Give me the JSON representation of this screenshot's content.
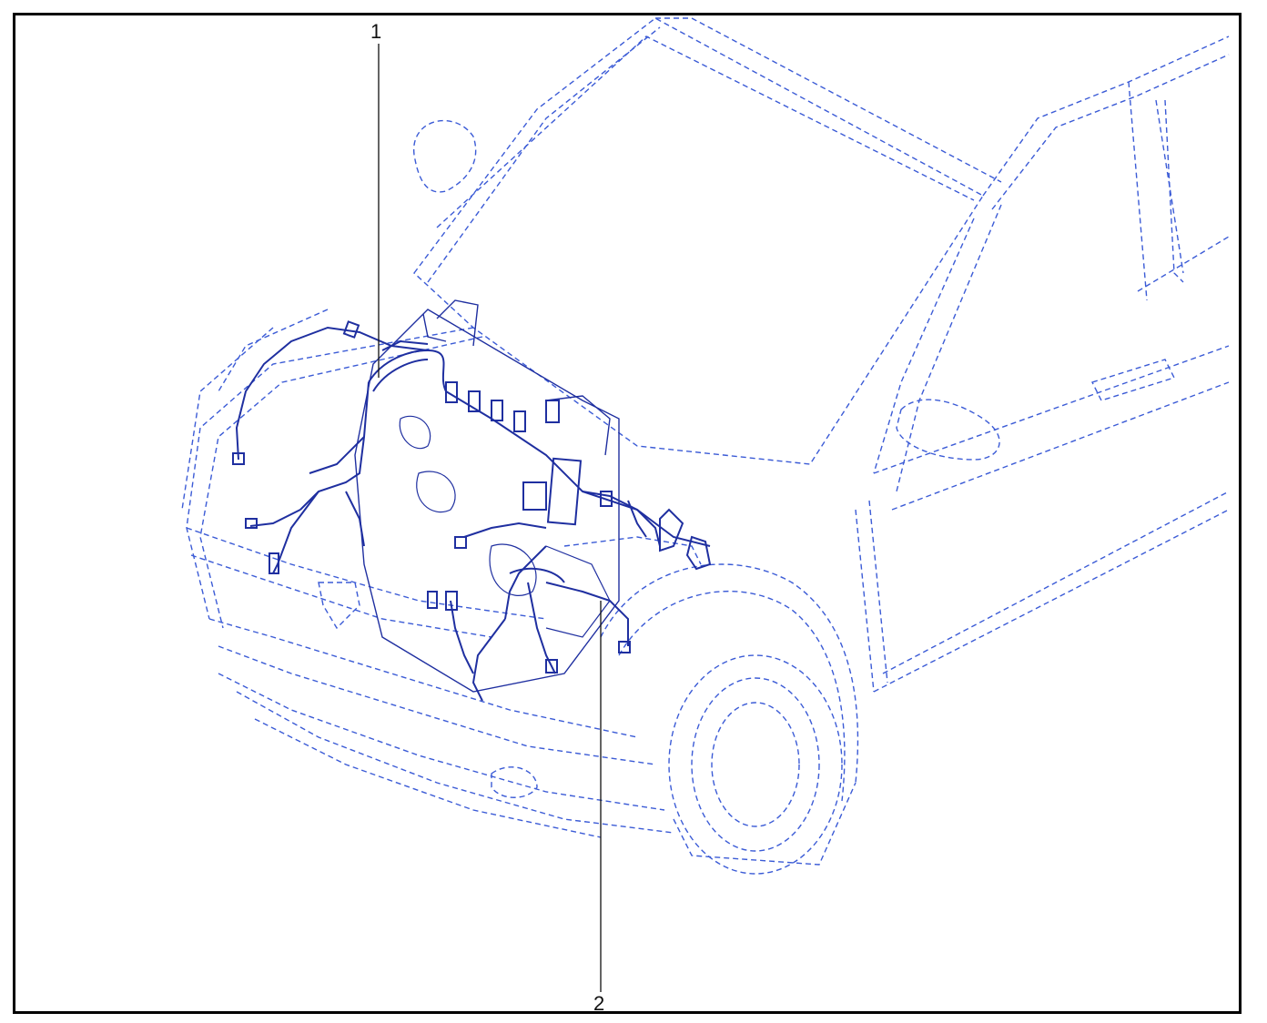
{
  "callouts": [
    {
      "id": "1",
      "label": "1"
    },
    {
      "id": "2",
      "label": "2"
    }
  ],
  "colors": {
    "outline": "#3b5bd6",
    "harness": "#1f2fa0",
    "callout_line": "#111111",
    "frame": "#000000"
  }
}
